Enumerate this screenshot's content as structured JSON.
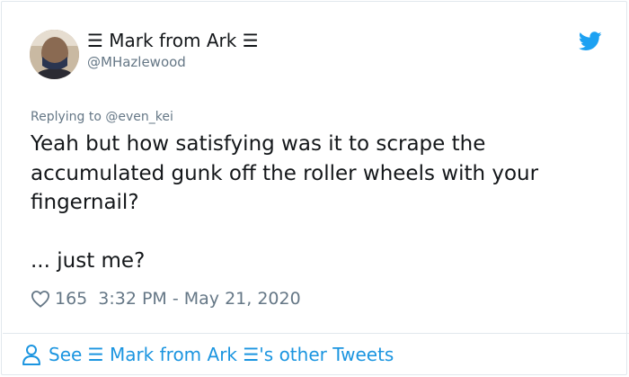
{
  "author": {
    "display_name": "☰ Mark from Ark ☰",
    "handle": "@MHazlewood",
    "avatar_icon": "user-avatar"
  },
  "brand": {
    "icon": "twitter-bird-icon",
    "color": "#1da1f2"
  },
  "tweet": {
    "replying_to": "Replying to @even_kei",
    "text": "Yeah but how satisfying was it to scrape the accumulated gunk off the roller wheels with your fingernail?\n\n... just me?",
    "likes": "165",
    "timestamp": "3:32 PM - May 21, 2020"
  },
  "footer": {
    "link_text": "See ☰ Mark from Ark ☰'s other Tweets",
    "icon": "person-icon",
    "link_color": "#1b95e0"
  }
}
